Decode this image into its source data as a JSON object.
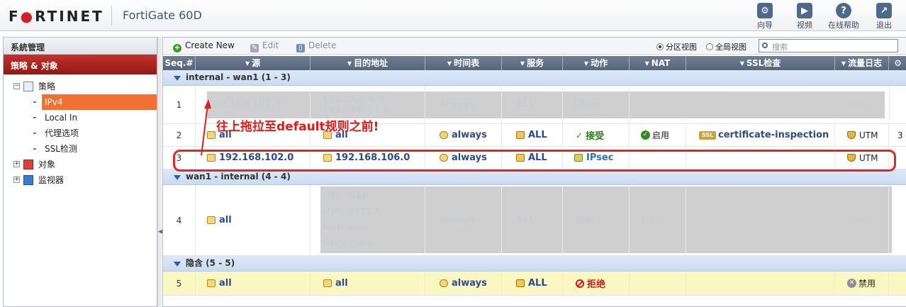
{
  "header": {
    "logo_left": "F",
    "logo_red": "●",
    "logo_right": "RTINET",
    "product": "FortiGate 60D",
    "buttons": [
      {
        "label": "向导",
        "icon": "wizard-icon"
      },
      {
        "label": "视频",
        "icon": "video-icon"
      },
      {
        "label": "在线帮助",
        "icon": "help-icon"
      },
      {
        "label": "退出",
        "icon": "logout-icon"
      }
    ]
  },
  "sidebar": {
    "system": "系統管理",
    "policy": "策略 & 对象",
    "tree": {
      "policy_root": "策略",
      "ipv4": "IPv4",
      "local_in": "Local In",
      "proxy": "代理选项",
      "ssl": "SSL检测",
      "objects": "对象",
      "monitor": "监视器"
    }
  },
  "toolbar": {
    "create": "Create New",
    "edit": "Edit",
    "delete": "Delete",
    "section_view": "分区视图",
    "global_view": "全局视图",
    "search_placeholder": "搜索"
  },
  "table": {
    "columns": [
      "Seq.#",
      "源",
      "目的地址",
      "时间表",
      "服务",
      "动作",
      "NAT",
      "SSL检查",
      "流量日志"
    ],
    "groups": [
      {
        "label": "internal - wan1 (1 - 3)"
      },
      {
        "label": "wan1 - internal (4 - 4)"
      },
      {
        "label": "隐含 (5 - 5)"
      }
    ],
    "rows": [
      {
        "seq": "1",
        "src": "192.168.102.0",
        "dst1": "192.168.8.0",
        "dst2": "192.168.11.0",
        "sched": "always",
        "svc": "ALL",
        "action": "IPsec",
        "nat": "",
        "ssl": "",
        "log": "UTM"
      },
      {
        "seq": "2",
        "src": "all",
        "dst": "all",
        "sched": "always",
        "svc": "ALL",
        "action": "接受",
        "nat": "启用",
        "ssl": "certificate-inspection",
        "log": "UTM",
        "extra": "3"
      },
      {
        "seq": "3",
        "src": "192.168.102.0",
        "dst": "192.168.106.0",
        "sched": "always",
        "svc": "ALL",
        "action": "IPsec",
        "nat": "",
        "ssl": "",
        "log": "UTM"
      },
      {
        "seq": "4",
        "src": "all",
        "dst_list": [
          "NEC WEB",
          "NVR 37777",
          "NVR web",
          "NECPCpro"
        ],
        "sched": "always",
        "svc": "ALL",
        "action": "接受",
        "nat": "禁用",
        "log": "禁用"
      },
      {
        "seq": "5",
        "src": "all",
        "dst": "all",
        "sched": "always",
        "svc": "ALL",
        "action": "拒绝",
        "log": "禁用"
      }
    ]
  },
  "annotation": "往上拖拉至default规则之前!"
}
